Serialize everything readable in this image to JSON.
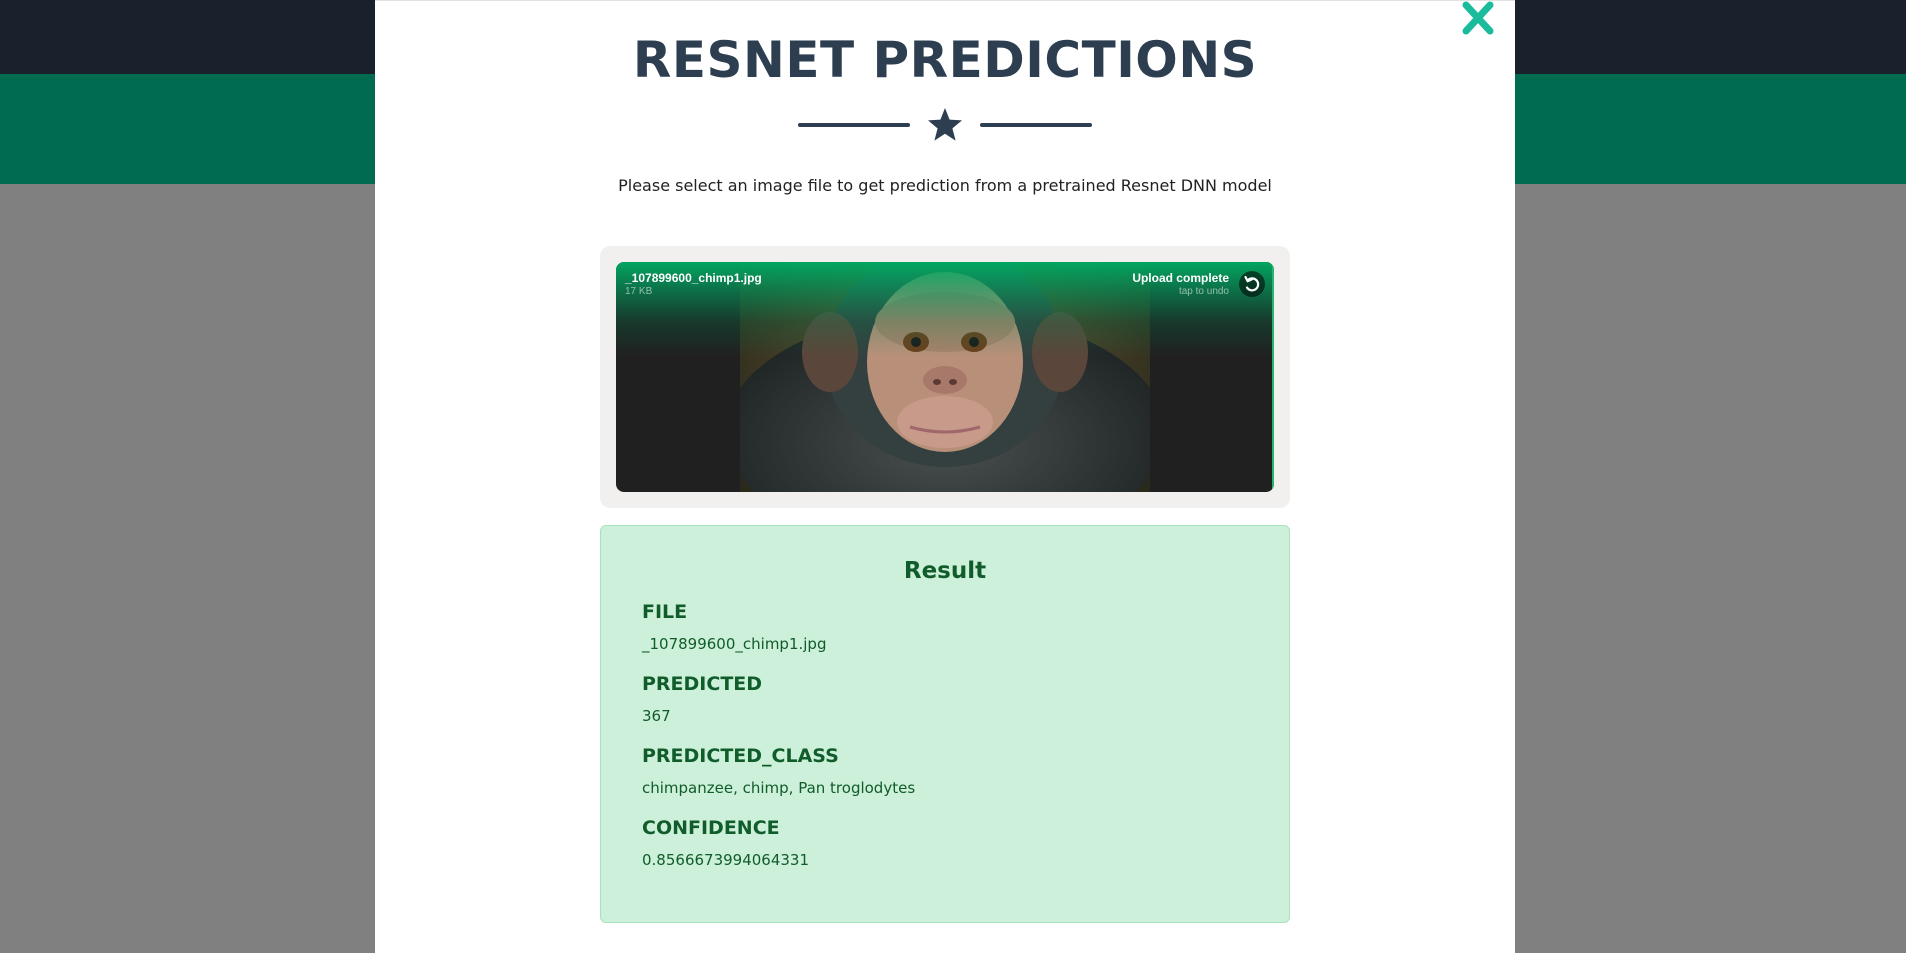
{
  "modal": {
    "title": "RESNET PREDICTIONS",
    "subtitle": "Please select an image file to get prediction from a pretrained Resnet DNN model"
  },
  "upload": {
    "file_name": "_107899600_chimp1.jpg",
    "file_size": "17 KB",
    "status": "Upload complete",
    "status_hint": "tap to undo"
  },
  "result": {
    "title": "Result",
    "fields": [
      {
        "label": "FILE",
        "value": "_107899600_chimp1.jpg"
      },
      {
        "label": "PREDICTED",
        "value": "367"
      },
      {
        "label": "PREDICTED_CLASS",
        "value": "chimpanzee, chimp, Pan troglodytes"
      },
      {
        "label": "CONFIDENCE",
        "value": "0.8566673994064331"
      }
    ]
  },
  "icons": {
    "close": "close-icon",
    "divider": "star-icon",
    "undo": "undo-icon"
  },
  "colors": {
    "navbar": "#1a202c",
    "masthead": "#006b4f",
    "title": "#2c3e50",
    "close": "#1abc9c",
    "result_bg": "#ccf0d9",
    "result_text": "#105c2a"
  }
}
